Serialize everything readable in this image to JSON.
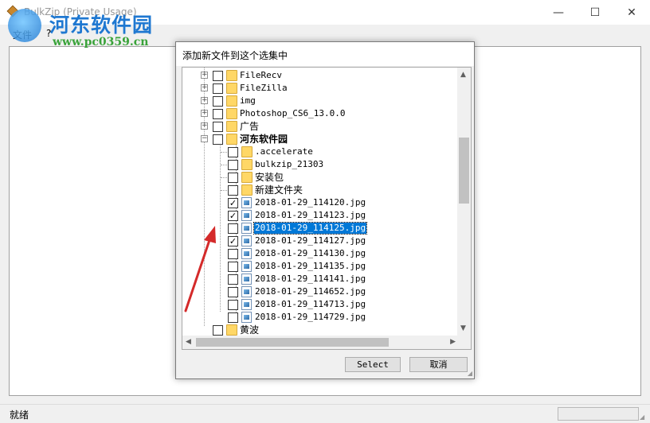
{
  "window": {
    "title": "BulkZip (Private Usage)",
    "menu": [
      "文件",
      "?"
    ],
    "controls": {
      "minimize": "—",
      "maximize": "☐",
      "close": "✕"
    }
  },
  "watermark": {
    "title": "河东软件园",
    "url": "www.pc0359.cn"
  },
  "dialog": {
    "title": "添加新文件到这个选集中",
    "select_label": "Select",
    "cancel_label": "取消"
  },
  "tree": {
    "top_items": [
      {
        "label": "FileRecv"
      },
      {
        "label": "FileZilla"
      },
      {
        "label": "img"
      },
      {
        "label": "Photoshop_CS6_13.0.0"
      },
      {
        "label": "广告"
      }
    ],
    "open_folder": {
      "label": "河东软件园"
    },
    "sub_folders": [
      {
        "label": ".accelerate"
      },
      {
        "label": "bulkzip_21303"
      },
      {
        "label": "安装包"
      },
      {
        "label": "新建文件夹"
      }
    ],
    "files": [
      {
        "label": "2018-01-29_114120.jpg",
        "checked": true
      },
      {
        "label": "2018-01-29_114123.jpg",
        "checked": true
      },
      {
        "label": "2018-01-29_114125.jpg",
        "checked": false,
        "selected": true
      },
      {
        "label": "2018-01-29_114127.jpg",
        "checked": true
      },
      {
        "label": "2018-01-29_114130.jpg",
        "checked": false
      },
      {
        "label": "2018-01-29_114135.jpg",
        "checked": false
      },
      {
        "label": "2018-01-29_114141.jpg",
        "checked": false
      },
      {
        "label": "2018-01-29_114652.jpg",
        "checked": false
      },
      {
        "label": "2018-01-29_114713.jpg",
        "checked": false
      },
      {
        "label": "2018-01-29_114729.jpg",
        "checked": false
      }
    ],
    "bottom_item": {
      "label": "黄波"
    }
  },
  "status": {
    "text": "就绪"
  },
  "colors": {
    "selection": "#0078d7",
    "annotation_arrow": "#d42a2a",
    "folder": "#ffd766"
  }
}
